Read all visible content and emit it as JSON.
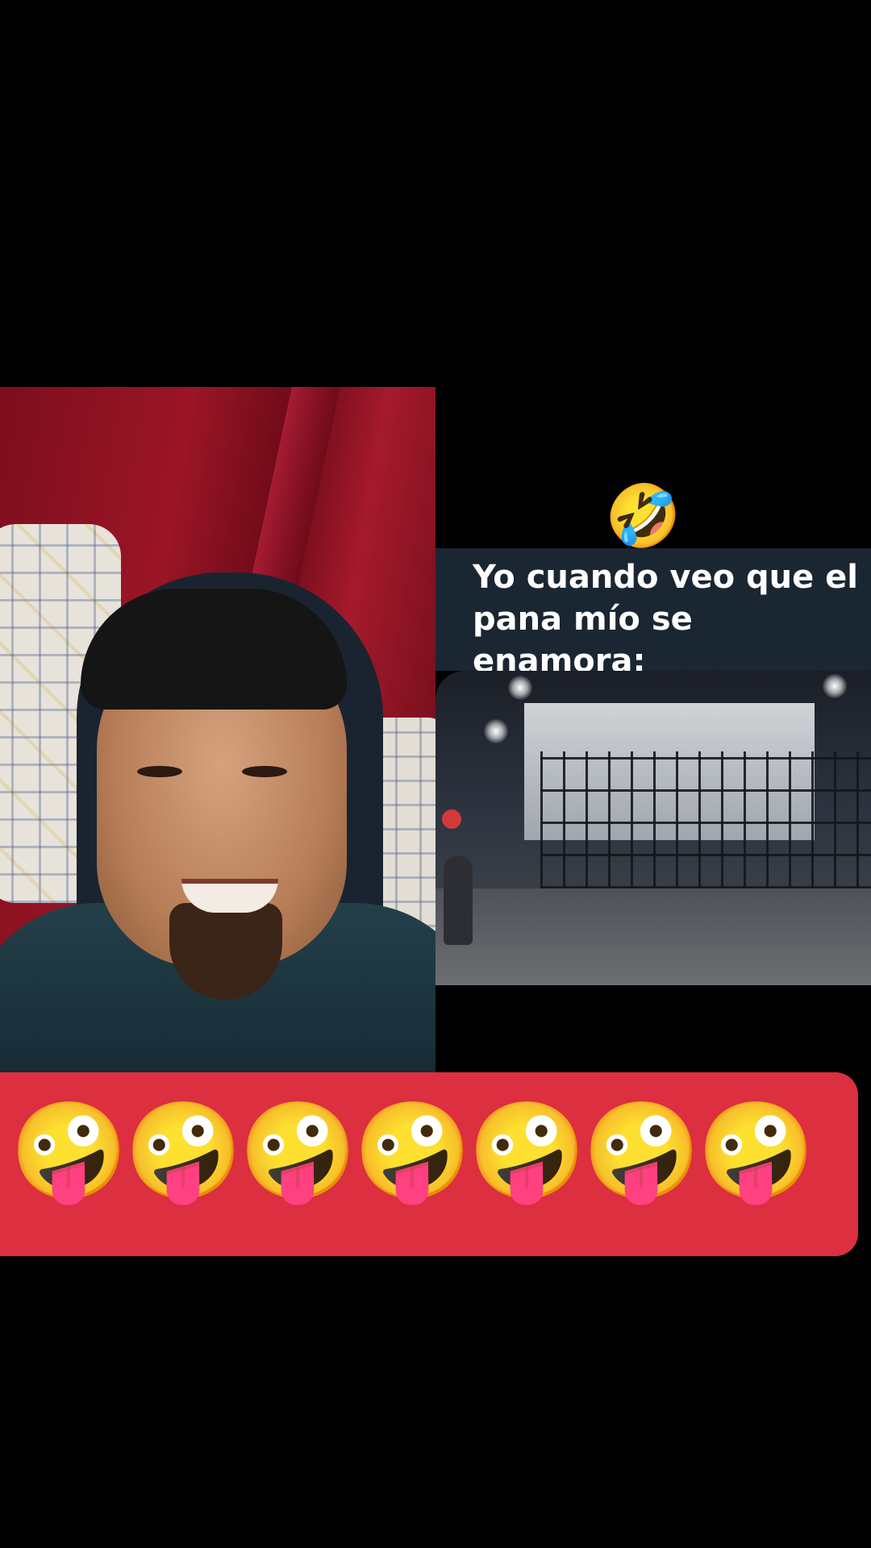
{
  "meme": {
    "top_emoji": "🤣",
    "caption": "Yo cuando veo que el pana mío se enamora:"
  },
  "banner": {
    "emojis": [
      "🤪",
      "🤪",
      "🤪",
      "🤪",
      "🤪",
      "🤪",
      "🤪"
    ]
  },
  "colors": {
    "background": "#000000",
    "caption_box": "#1b2633",
    "banner": "#dc2f3f"
  }
}
